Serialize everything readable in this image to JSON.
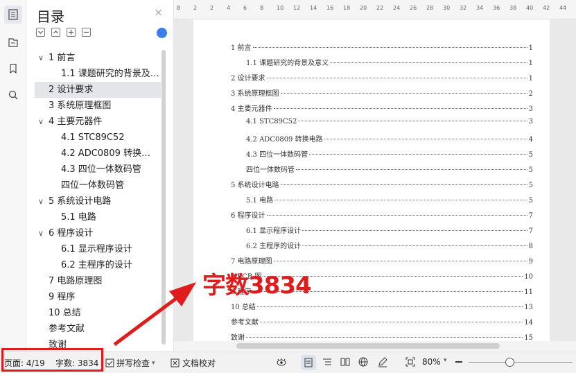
{
  "panel": {
    "title": "目录",
    "close": "×",
    "toc": [
      {
        "label": "1 前言",
        "level": 1,
        "caret": true
      },
      {
        "label": "1.1 课题研究的背景及…",
        "level": 2
      },
      {
        "label": "2 设计要求",
        "level": 1,
        "selected": true
      },
      {
        "label": "3 系统原理框图",
        "level": 1
      },
      {
        "label": "4 主要元器件",
        "level": 1,
        "caret": true
      },
      {
        "label": "4.1 STC89C52",
        "level": 2
      },
      {
        "label": "4.2 ADC0809 转换…",
        "level": 2
      },
      {
        "label": "4.3 四位一体数码管",
        "level": 2
      },
      {
        "label": "四位一体数码管",
        "level": 2
      },
      {
        "label": "5 系统设计电路",
        "level": 1,
        "caret": true
      },
      {
        "label": "5.1 电路",
        "level": 2
      },
      {
        "label": "6 程序设计",
        "level": 1,
        "caret": true
      },
      {
        "label": "6.1 显示程序设计",
        "level": 2
      },
      {
        "label": "6.2 主程序的设计",
        "level": 2
      },
      {
        "label": "7 电路原理图",
        "level": 1
      },
      {
        "label": "9 程序",
        "level": 1
      },
      {
        "label": "10 总结",
        "level": 1
      },
      {
        "label": "参考文献",
        "level": 1
      },
      {
        "label": "致谢",
        "level": 1
      }
    ]
  },
  "ruler": [
    "8",
    "2",
    "2",
    "4",
    "6",
    "8",
    "10",
    "12",
    "14",
    "16",
    "18",
    "20",
    "22",
    "24",
    "26",
    "28",
    "30",
    "32",
    "34",
    "36",
    "38",
    "40",
    "42",
    "44"
  ],
  "document": {
    "lines": [
      {
        "text": "1 前言",
        "page": "1",
        "indent": 0
      },
      {
        "text": "1.1 课题研究的背景及意义",
        "page": "1",
        "indent": 1
      },
      {
        "text": "2 设计要求",
        "page": "1",
        "indent": 0
      },
      {
        "text": "3 系统原理框图",
        "page": "2",
        "indent": 0
      },
      {
        "text": "4 主要元器件",
        "page": "3",
        "indent": 0
      },
      {
        "text": "4.1  STC89C52",
        "page": "3",
        "indent": 1
      },
      {
        "text": "4.2  ADC0809 转换电路",
        "page": "4",
        "indent": 1
      },
      {
        "text": "4.3 四位一体数码管",
        "page": "5",
        "indent": 1
      },
      {
        "text": "四位一体数码管",
        "page": "5",
        "indent": 1
      },
      {
        "text": "5 系统设计电路",
        "page": "5",
        "indent": 0
      },
      {
        "text": "5.1 电路",
        "page": "5",
        "indent": 1
      },
      {
        "text": "6 程序设计",
        "page": "7",
        "indent": 0
      },
      {
        "text": "6.1 显示程序设计",
        "page": "7",
        "indent": 1
      },
      {
        "text": "6.2 主程序的设计",
        "page": "8",
        "indent": 1
      },
      {
        "text": "7 电路原理图",
        "page": "9",
        "indent": 0
      },
      {
        "text": "8 PCB 图",
        "page": "10",
        "indent": 0
      },
      {
        "text": "9 程序",
        "page": "11",
        "indent": 0
      },
      {
        "text": "10 总结",
        "page": "13",
        "indent": 0
      },
      {
        "text": "参考文献",
        "page": "14",
        "indent": 0
      },
      {
        "text": "致谢",
        "page": "15",
        "indent": 0
      }
    ]
  },
  "annotation": "字数3834",
  "status": {
    "page": "页面: 4/19",
    "words": "字数: 3834",
    "spell": "拼写检查",
    "proof": "文档校对",
    "zoom": "80%"
  },
  "colors": {
    "highlight": "#e01b1b",
    "accent": "#3b7de9"
  }
}
